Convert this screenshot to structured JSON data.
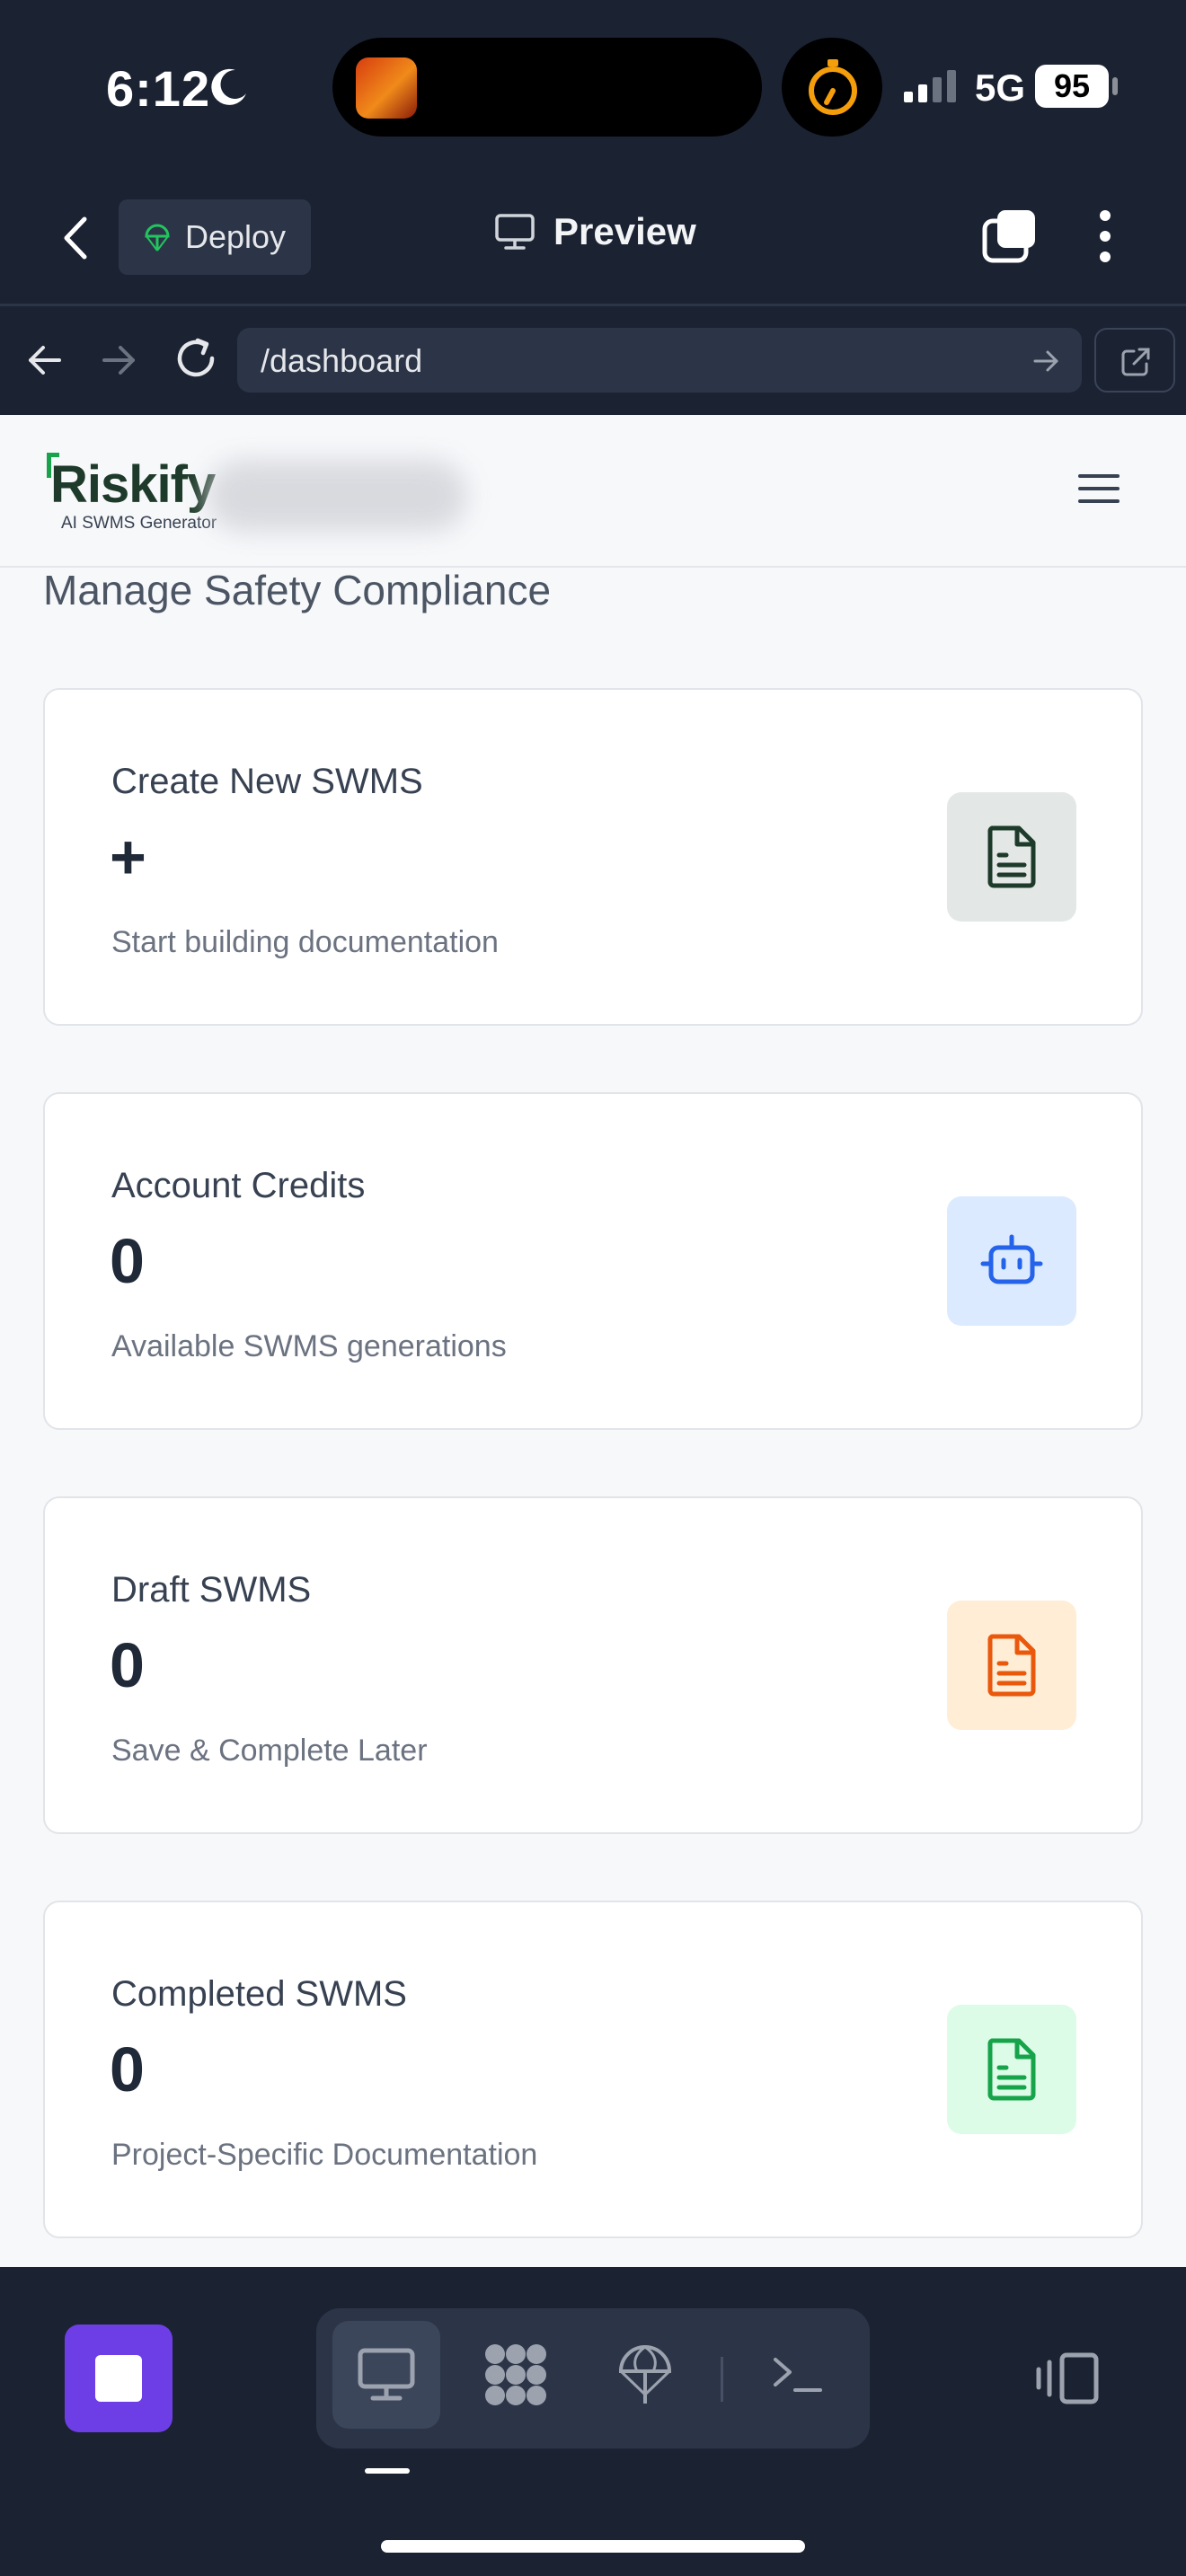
{
  "status_bar": {
    "time": "6:12",
    "network": "5G",
    "battery": "95"
  },
  "app_header": {
    "deploy_label": "Deploy",
    "preview_label": "Preview"
  },
  "browser": {
    "url": "/dashboard"
  },
  "site": {
    "logo_text": "Riskify",
    "logo_tagline": "AI SWMS Generator",
    "subtitle": "Manage Safety Compliance"
  },
  "cards": [
    {
      "title": "Create New SWMS",
      "value": "+",
      "description": "Start building documentation",
      "icon": "document-icon",
      "icon_bg": "#e3e8e6",
      "icon_color": "#1e3a2a"
    },
    {
      "title": "Account Credits",
      "value": "0",
      "description": "Available SWMS generations",
      "icon": "robot-icon",
      "icon_bg": "#dbeafe",
      "icon_color": "#2563eb"
    },
    {
      "title": "Draft SWMS",
      "value": "0",
      "description": "Save & Complete Later",
      "icon": "document-icon",
      "icon_bg": "#ffedd5",
      "icon_color": "#ea580c"
    },
    {
      "title": "Completed SWMS",
      "value": "0",
      "description": "Project-Specific Documentation",
      "icon": "document-icon",
      "icon_bg": "#dcfce7",
      "icon_color": "#16a34a"
    }
  ],
  "bottom_bar": {
    "modes": [
      "desktop-icon",
      "apps-icon",
      "deploy-icon",
      "terminal-icon"
    ],
    "active_mode": "desktop-icon"
  }
}
